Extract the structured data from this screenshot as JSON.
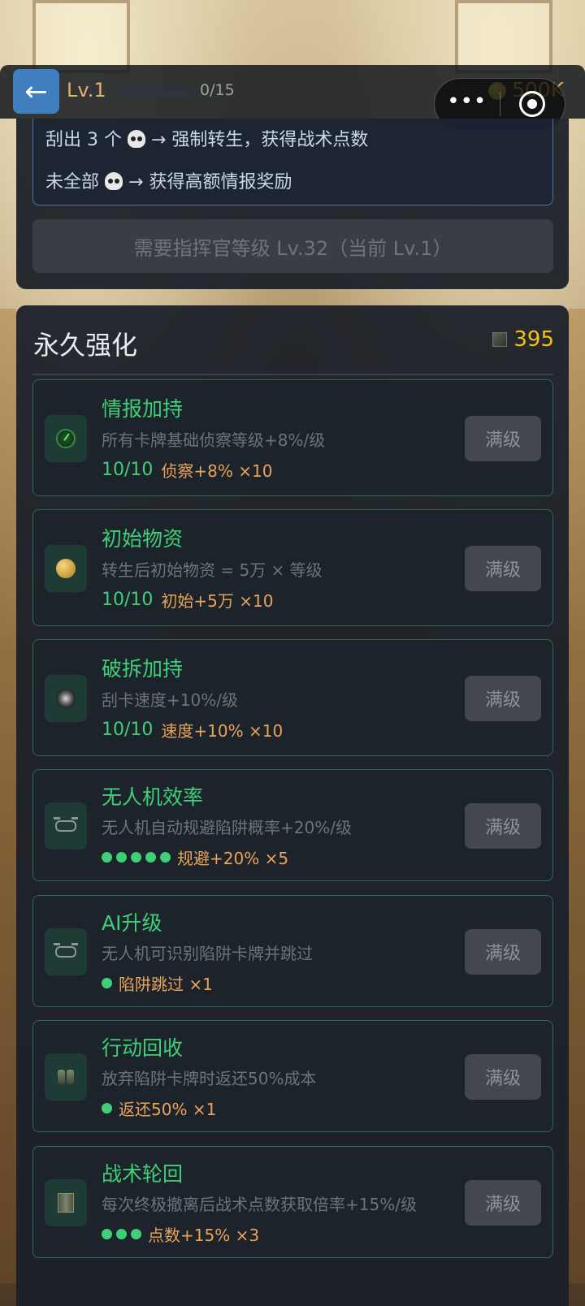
{
  "topbar": {
    "back_icon": "arrow-left-icon",
    "level_label": "Lv.1",
    "level_progress_text": "0/15",
    "level_progress_fraction": 0.0,
    "coin_value": "500K",
    "menu_dots": "•••"
  },
  "convert": {
    "line1_pre": "刮出 3 个",
    "line1_post": "→ 强制转生，获得战术点数",
    "line2_pre": "未全部",
    "line2_post": "→ 获得高额情报奖励",
    "button_label": "需要指挥官等级 Lv.32（当前 Lv.1）"
  },
  "permanent": {
    "title": "永久强化",
    "resource_value": "395",
    "cards": [
      {
        "icon": "radar-icon",
        "title": "情报加持",
        "desc": "所有卡牌基础侦察等级+8%/级",
        "level": "10/10",
        "pips": 0,
        "effect": "侦察+8% ×10",
        "button": "满级"
      },
      {
        "icon": "coin-icon",
        "title": "初始物资",
        "desc": "转生后初始物资 = 5万 × 等级",
        "level": "10/10",
        "pips": 0,
        "effect": "初始+5万 ×10",
        "button": "满级"
      },
      {
        "icon": "blast-icon",
        "title": "破拆加持",
        "desc": "刮卡速度+10%/级",
        "level": "10/10",
        "pips": 0,
        "effect": "速度+10% ×10",
        "button": "满级"
      },
      {
        "icon": "drone-icon",
        "title": "无人机效率",
        "desc": "无人机自动规避陷阱概率+20%/级",
        "level": "",
        "pips": 5,
        "effect": "规避+20% ×5",
        "button": "满级"
      },
      {
        "icon": "drone-icon",
        "title": "AI升级",
        "desc": "无人机可识别陷阱卡牌并跳过",
        "level": "",
        "pips": 1,
        "effect": "陷阱跳过 ×1",
        "button": "满级"
      },
      {
        "icon": "binoculars-icon",
        "title": "行动回收",
        "desc": "放弃陷阱卡牌时返还50%成本",
        "level": "",
        "pips": 1,
        "effect": "返还50% ×1",
        "button": "满级"
      },
      {
        "icon": "book-icon",
        "title": "战术轮回",
        "desc": "每次终极撤离后战术点数获取倍率+15%/级",
        "level": "",
        "pips": 3,
        "effect": "点数+15% ×3",
        "button": "满级"
      }
    ]
  },
  "colors": {
    "accent_green": "#3fcf78",
    "effect_orange": "#e9a35a",
    "gold": "#f0c31a",
    "level_orange": "#e2b06a",
    "back_button_blue": "#3f7fbf"
  }
}
